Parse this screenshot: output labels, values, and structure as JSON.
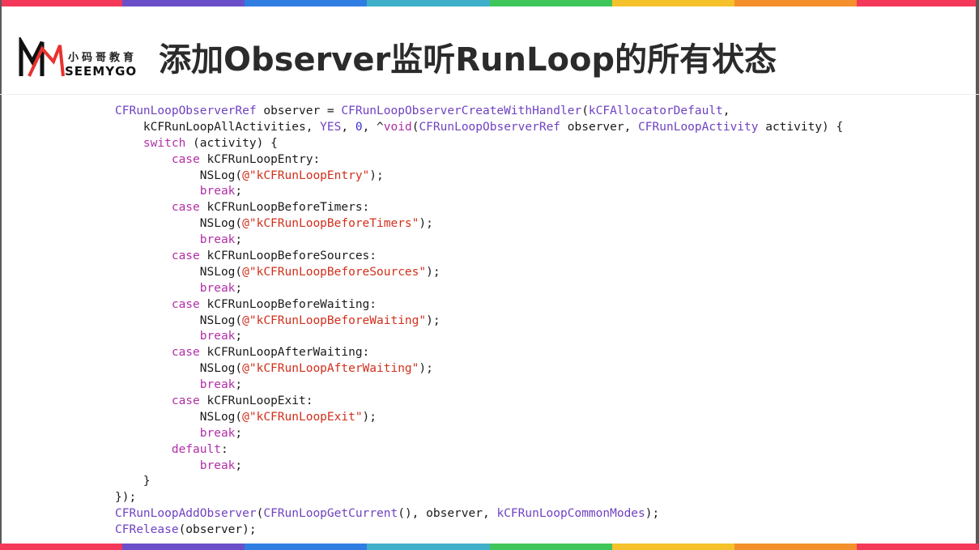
{
  "slide": {
    "title": "添加Observer监听RunLoop的所有状态",
    "stripe_colors": [
      "#f4385a",
      "#6a4fc8",
      "#2f7de1",
      "#3fb0c9",
      "#3fc65b",
      "#f5c22b",
      "#f4902b",
      "#f4385a"
    ]
  },
  "logo": {
    "name_cn": "小码哥教育",
    "name_en": "SEEMYGO",
    "mark_colors": [
      "#e8322f",
      "#111111"
    ]
  },
  "code": {
    "language": "objective-c",
    "colors": {
      "type": "#6f42c1",
      "keyword": "#b12fa6",
      "string": "#d12f1b",
      "number": "#3b2ed1",
      "plain": "#1a1a1a"
    },
    "lines": [
      [
        [
          "t",
          "CFRunLoopObserverRef"
        ],
        [
          "p",
          " observer = "
        ],
        [
          "t",
          "CFRunLoopObserverCreateWithHandler"
        ],
        [
          "p",
          "("
        ],
        [
          "c",
          "kCFAllocatorDefault"
        ],
        [
          "p",
          ","
        ]
      ],
      [
        [
          "p",
          "    kCFRunLoopAllActivities, "
        ],
        [
          "c",
          "YES"
        ],
        [
          "p",
          ", "
        ],
        [
          "n",
          "0"
        ],
        [
          "p",
          ", ^"
        ],
        [
          "k",
          "void"
        ],
        [
          "p",
          "("
        ],
        [
          "t",
          "CFRunLoopObserverRef"
        ],
        [
          "p",
          " observer, "
        ],
        [
          "t",
          "CFRunLoopActivity"
        ],
        [
          "p",
          " activity) {"
        ]
      ],
      [
        [
          "p",
          "    "
        ],
        [
          "k",
          "switch"
        ],
        [
          "p",
          " (activity) {"
        ]
      ],
      [
        [
          "p",
          "        "
        ],
        [
          "k",
          "case"
        ],
        [
          "p",
          " kCFRunLoopEntry:"
        ]
      ],
      [
        [
          "p",
          "            NSLog("
        ],
        [
          "s",
          "@\"kCFRunLoopEntry\""
        ],
        [
          "p",
          ");"
        ]
      ],
      [
        [
          "p",
          "            "
        ],
        [
          "k",
          "break"
        ],
        [
          "p",
          ";"
        ]
      ],
      [
        [
          "p",
          "        "
        ],
        [
          "k",
          "case"
        ],
        [
          "p",
          " kCFRunLoopBeforeTimers:"
        ]
      ],
      [
        [
          "p",
          "            NSLog("
        ],
        [
          "s",
          "@\"kCFRunLoopBeforeTimers\""
        ],
        [
          "p",
          ");"
        ]
      ],
      [
        [
          "p",
          "            "
        ],
        [
          "k",
          "break"
        ],
        [
          "p",
          ";"
        ]
      ],
      [
        [
          "p",
          "        "
        ],
        [
          "k",
          "case"
        ],
        [
          "p",
          " kCFRunLoopBeforeSources:"
        ]
      ],
      [
        [
          "p",
          "            NSLog("
        ],
        [
          "s",
          "@\"kCFRunLoopBeforeSources\""
        ],
        [
          "p",
          ");"
        ]
      ],
      [
        [
          "p",
          "            "
        ],
        [
          "k",
          "break"
        ],
        [
          "p",
          ";"
        ]
      ],
      [
        [
          "p",
          "        "
        ],
        [
          "k",
          "case"
        ],
        [
          "p",
          " kCFRunLoopBeforeWaiting:"
        ]
      ],
      [
        [
          "p",
          "            NSLog("
        ],
        [
          "s",
          "@\"kCFRunLoopBeforeWaiting\""
        ],
        [
          "p",
          ");"
        ]
      ],
      [
        [
          "p",
          "            "
        ],
        [
          "k",
          "break"
        ],
        [
          "p",
          ";"
        ]
      ],
      [
        [
          "p",
          "        "
        ],
        [
          "k",
          "case"
        ],
        [
          "p",
          " kCFRunLoopAfterWaiting:"
        ]
      ],
      [
        [
          "p",
          "            NSLog("
        ],
        [
          "s",
          "@\"kCFRunLoopAfterWaiting\""
        ],
        [
          "p",
          ");"
        ]
      ],
      [
        [
          "p",
          "            "
        ],
        [
          "k",
          "break"
        ],
        [
          "p",
          ";"
        ]
      ],
      [
        [
          "p",
          "        "
        ],
        [
          "k",
          "case"
        ],
        [
          "p",
          " kCFRunLoopExit:"
        ]
      ],
      [
        [
          "p",
          "            NSLog("
        ],
        [
          "s",
          "@\"kCFRunLoopExit\""
        ],
        [
          "p",
          ");"
        ]
      ],
      [
        [
          "p",
          "            "
        ],
        [
          "k",
          "break"
        ],
        [
          "p",
          ";"
        ]
      ],
      [
        [
          "p",
          "        "
        ],
        [
          "k",
          "default"
        ],
        [
          "p",
          ":"
        ]
      ],
      [
        [
          "p",
          "            "
        ],
        [
          "k",
          "break"
        ],
        [
          "p",
          ";"
        ]
      ],
      [
        [
          "p",
          "    }"
        ]
      ],
      [
        [
          "p",
          "});"
        ]
      ],
      [
        [
          "t",
          "CFRunLoopAddObserver"
        ],
        [
          "p",
          "("
        ],
        [
          "t",
          "CFRunLoopGetCurrent"
        ],
        [
          "p",
          "(), observer, "
        ],
        [
          "c",
          "kCFRunLoopCommonModes"
        ],
        [
          "p",
          ");"
        ]
      ],
      [
        [
          "t",
          "CFRelease"
        ],
        [
          "p",
          "(observer);"
        ]
      ]
    ]
  }
}
